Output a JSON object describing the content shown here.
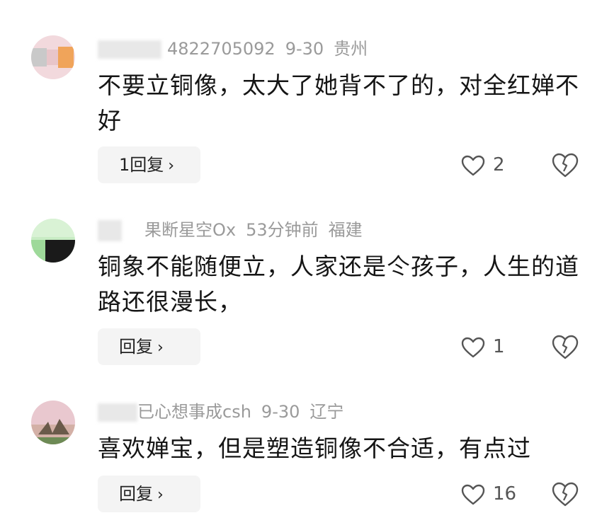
{
  "comments": [
    {
      "username": "4822705092",
      "date": "9-30",
      "location": "贵州",
      "text": "不要立铜像，太大了她背不了的，对全红婵不好",
      "reply_label": "1回复",
      "likes": "2"
    },
    {
      "username": "果断星空Ox",
      "date": "53分钟前",
      "location": "福建",
      "text": "铜象不能随便立，人家还是仒孩子，人生的道路还很漫长，",
      "reply_label": "回复",
      "likes": "1"
    },
    {
      "username": "已心想事成csh",
      "date": "9-30",
      "location": "辽宁",
      "text": "喜欢婵宝，但是塑造铜像不合适，有点过",
      "reply_label": "回复",
      "likes": "16"
    }
  ],
  "icons": {
    "like": "heart-outline-icon",
    "dislike": "broken-heart-icon",
    "reply_chevron": "chevron-right-icon"
  },
  "colors": {
    "meta": "#9a9a9a",
    "reply_bg": "#f4f4f4"
  }
}
